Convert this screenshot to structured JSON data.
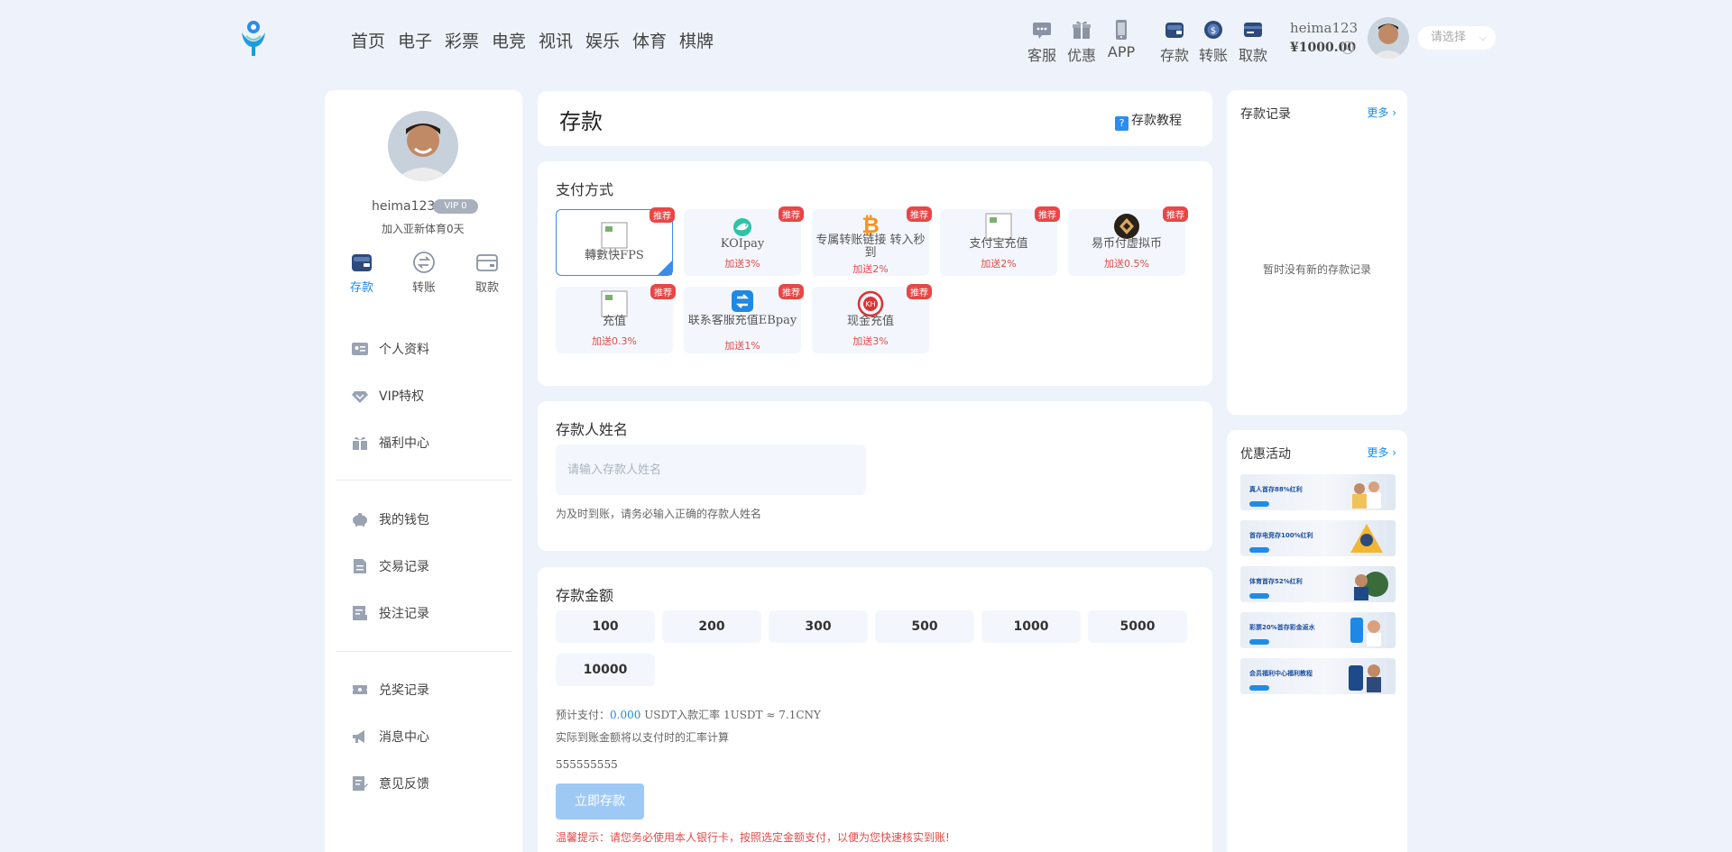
{
  "header": {
    "nav": [
      "首页",
      "电子",
      "彩票",
      "电竞",
      "视讯",
      "娱乐",
      "体育",
      "棋牌"
    ],
    "tools": [
      "客服",
      "优惠",
      "APP"
    ],
    "actions": [
      "存款",
      "转账",
      "取款"
    ],
    "username": "heima123",
    "balance": "¥1000.00",
    "select_placeholder": "请选择"
  },
  "profile": {
    "username": "heima123",
    "vip": "VIP 0",
    "joined": "加入亚新体育0天",
    "quick_actions": [
      "存款",
      "转账",
      "取款"
    ],
    "menu_group1": [
      "个人资料",
      "VIP特权",
      "福利中心"
    ],
    "menu_group2": [
      "我的钱包",
      "交易记录",
      "投注记录"
    ],
    "menu_group3": [
      "兑奖记录",
      "消息中心",
      "意见反馈"
    ]
  },
  "deposit": {
    "title": "存款",
    "tutorial": "存款教程",
    "methods_title": "支付方式",
    "tag": "推荐",
    "methods": [
      {
        "name": "轉數快FPS",
        "bonus": ""
      },
      {
        "name": "KOIpay",
        "bonus": "加送3%"
      },
      {
        "name": "专属转账链接 转入秒到",
        "bonus": "加送2%"
      },
      {
        "name": "支付宝充值",
        "bonus": "加送2%"
      },
      {
        "name": "易币付虚拟币",
        "bonus": "加送0.5%"
      },
      {
        "name": "充值",
        "bonus": "加送0.3%"
      },
      {
        "name": "联系客服充值EBpay",
        "bonus": "加送1%"
      },
      {
        "name": "现金充值",
        "bonus": "加送3%"
      }
    ],
    "name_title": "存款人姓名",
    "name_placeholder": "请输入存款人姓名",
    "name_hint": "为及时到账，请务必输入正确的存款人姓名",
    "amount_title": "存款金额",
    "amounts": [
      "100",
      "200",
      "300",
      "500",
      "1000",
      "5000",
      "10000"
    ],
    "est_prefix": "预计支付：",
    "est_value": "0.000",
    "est_suffix": " USDT入款汇率 1USDT ≈ 7.1CNY",
    "rate_note": "实际到账金额将以支付时的汇率计算",
    "account": "555555555",
    "submit": "立即存款",
    "tip": "温馨提示：请您务必使用本人银行卡，按照选定金额支付，以便为您快速核实到账!"
  },
  "records": {
    "title": "存款记录",
    "more": "更多",
    "empty": "暂时没有新的存款记录"
  },
  "promos": {
    "title": "优惠活动",
    "more": "更多",
    "banners": [
      "真人首存88%红利",
      "首存电竞存100%红利",
      "体育首存52%红利",
      "彩票20%首存彩金返水",
      "会员福利中心福利教程"
    ]
  },
  "colors": {
    "accent": "#1e88e5",
    "bonus": "#e34a4a",
    "tag": "#e94646",
    "background": "#eef3fb"
  }
}
